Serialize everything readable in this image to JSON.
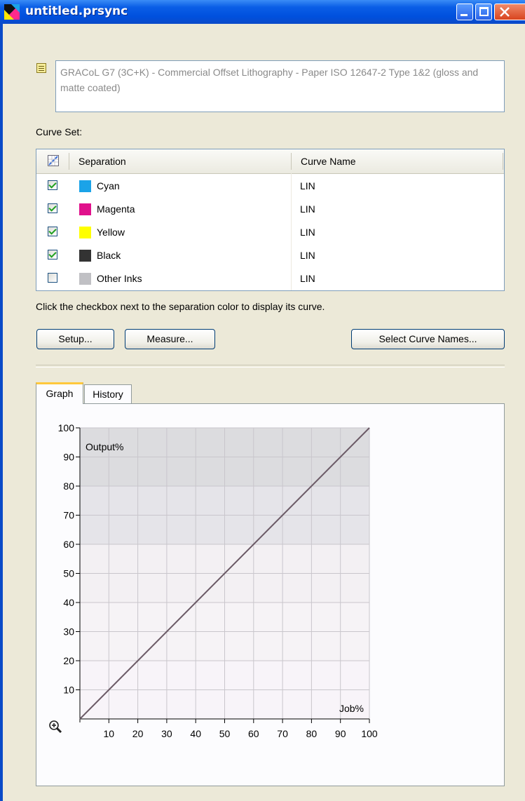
{
  "window": {
    "title": "untitled.prsync",
    "minimize_icon": "minimize-icon",
    "maximize_icon": "maximize-icon",
    "close_icon": "close-icon",
    "app_icon": "app-icon"
  },
  "description": {
    "icon": "note-icon",
    "text": "GRACoL G7 (3C+K) - Commercial Offset Lithography - Paper ISO 12647-2 Type 1&2 (gloss and matte coated)"
  },
  "curve_set": {
    "label": "Curve Set:",
    "header_icon": "curve-icon",
    "columns": [
      "Separation",
      "Curve Name"
    ],
    "rows": [
      {
        "checked": true,
        "color": "#1ba3e8",
        "separation": "Cyan",
        "curve": "LIN"
      },
      {
        "checked": true,
        "color": "#e0118c",
        "separation": "Magenta",
        "curve": "LIN"
      },
      {
        "checked": true,
        "color": "#ffff00",
        "separation": "Yellow",
        "curve": "LIN"
      },
      {
        "checked": true,
        "color": "#333333",
        "separation": "Black",
        "curve": "LIN"
      },
      {
        "checked": false,
        "color": "#c0c0c4",
        "separation": "Other Inks",
        "curve": "LIN"
      }
    ],
    "hint": "Click the checkbox next to the separation color to display its curve."
  },
  "buttons": {
    "setup": "Setup...",
    "measure": "Measure...",
    "select_curve_names": "Select Curve Names..."
  },
  "tabs": [
    {
      "label": "Graph",
      "active": true
    },
    {
      "label": "History",
      "active": false
    }
  ],
  "chart_data": {
    "type": "line",
    "xlabel": "Job%",
    "ylabel": "Output%",
    "xlim": [
      0,
      100
    ],
    "ylim": [
      0,
      100
    ],
    "xticks": [
      10,
      20,
      30,
      40,
      50,
      60,
      70,
      80,
      90,
      100
    ],
    "yticks": [
      10,
      20,
      30,
      40,
      50,
      60,
      70,
      80,
      90,
      100
    ],
    "grid": true,
    "series": [
      {
        "color": "#6b5a66",
        "x": [
          0,
          100
        ],
        "y": [
          0,
          100
        ]
      }
    ],
    "zoom_icon": "zoom-in-icon"
  }
}
